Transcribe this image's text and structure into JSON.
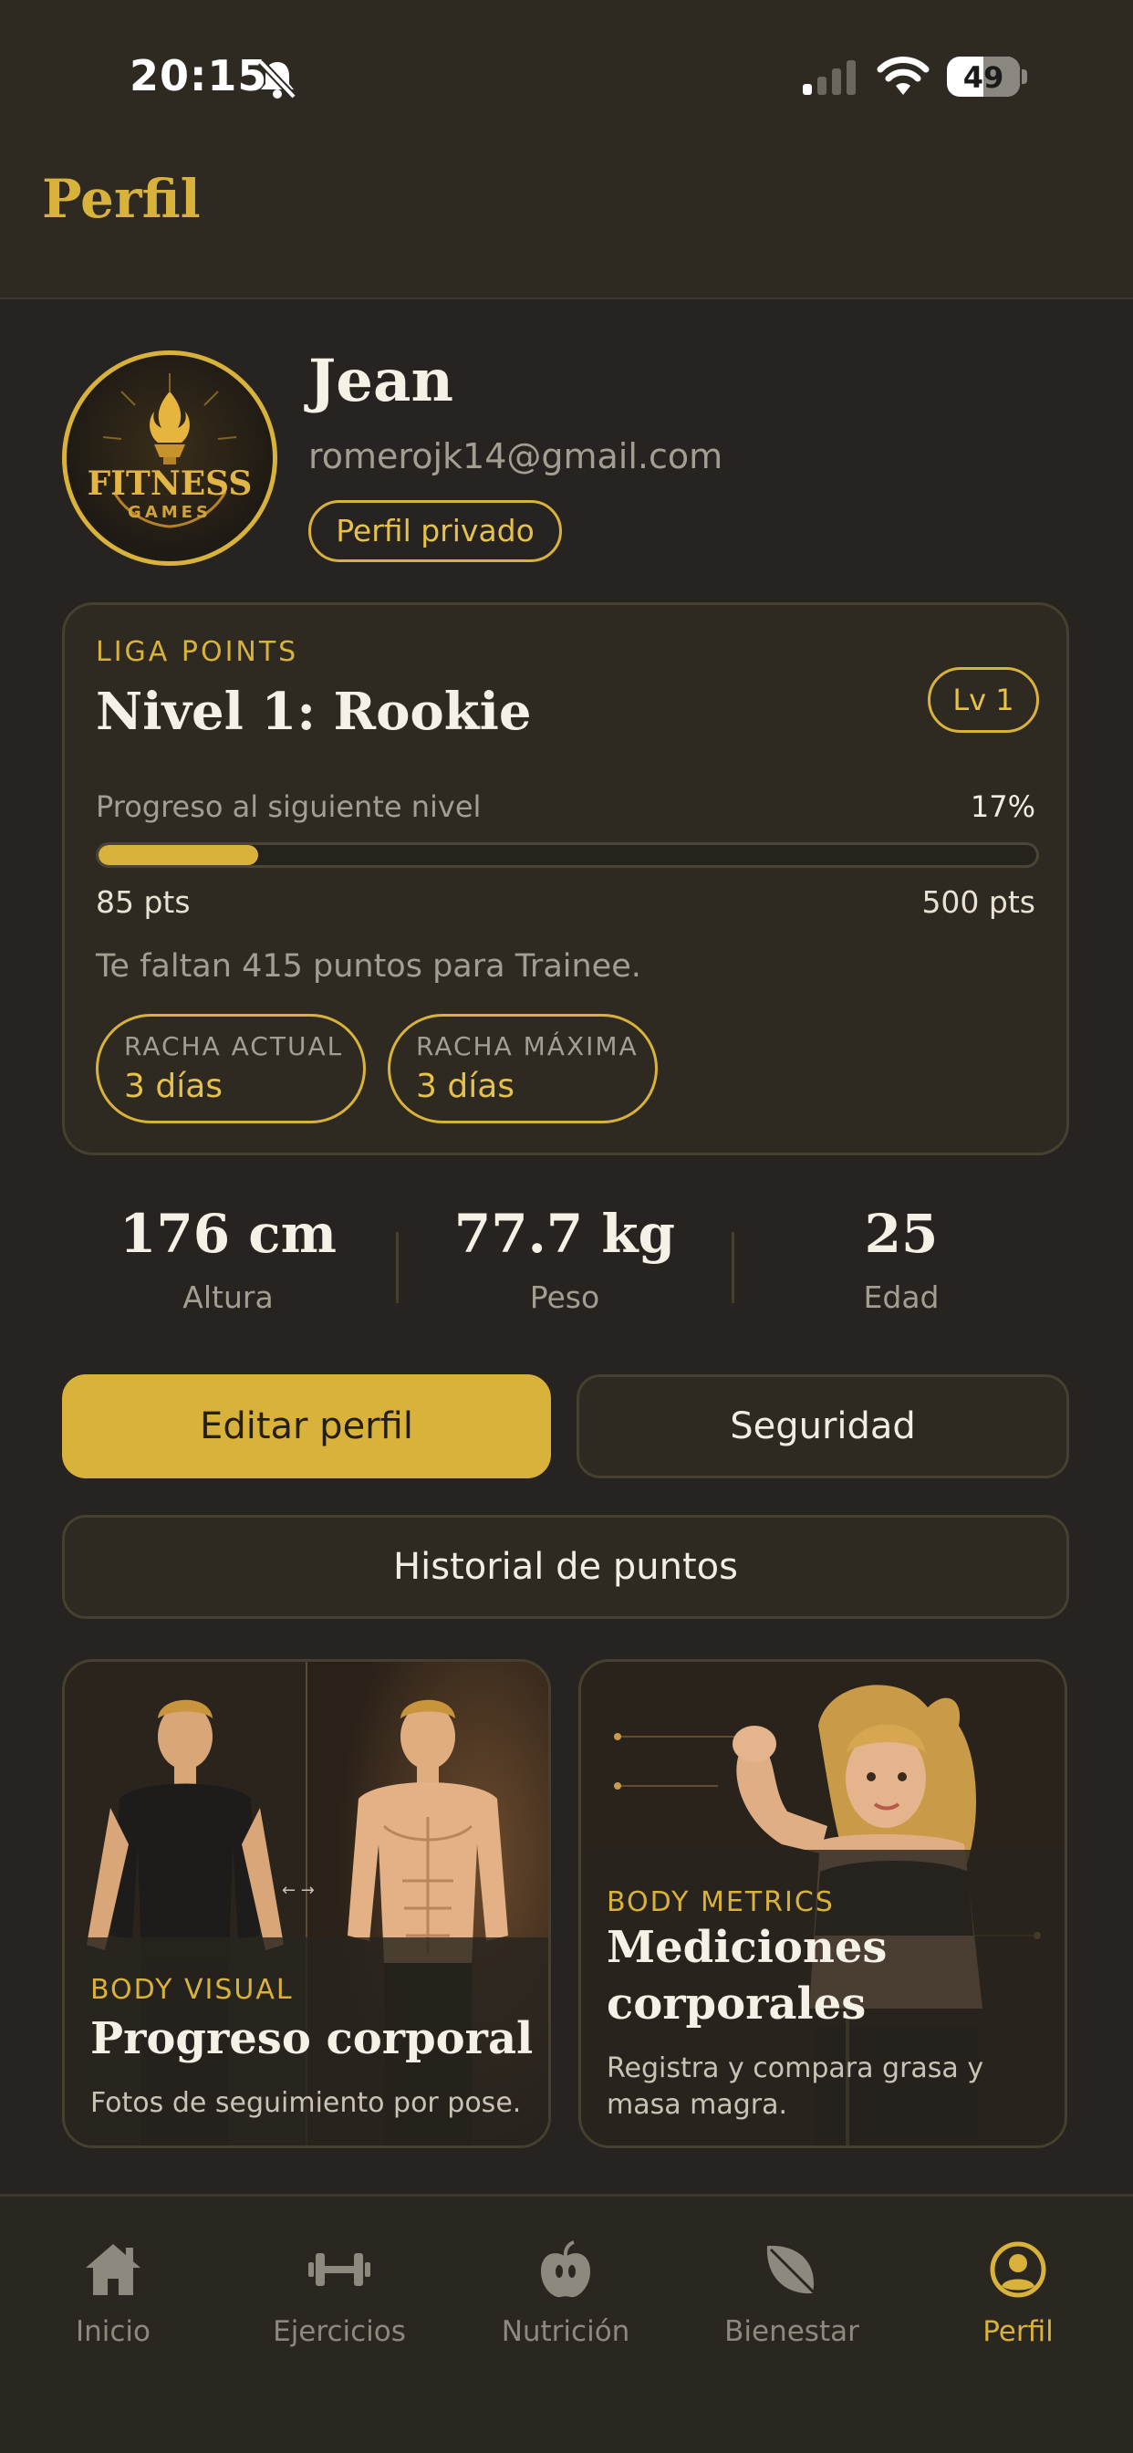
{
  "status_bar": {
    "time": "20:15",
    "battery": "49"
  },
  "header": {
    "title": "Perfil"
  },
  "profile": {
    "name": "Jean",
    "email": "romerojk14@gmail.com",
    "privacy_badge": "Perfil privado",
    "avatar_logo_line1": "FITNESS",
    "avatar_logo_line2": "GAMES"
  },
  "league": {
    "label": "LIGA POINTS",
    "level_title": "Nivel 1: Rookie",
    "level_badge": "Lv 1",
    "progress_label": "Progreso al siguiente nivel",
    "progress_percent_text": "17%",
    "progress_value": 0.17,
    "points_current": "85 pts",
    "points_next": "500 pts",
    "remaining_text": "Te faltan 415 puntos para Trainee.",
    "streaks": [
      {
        "label": "RACHA ACTUAL",
        "value": "3 días"
      },
      {
        "label": "RACHA MÁXIMA",
        "value": "3 días"
      }
    ]
  },
  "stats": [
    {
      "value": "176 cm",
      "label": "Altura"
    },
    {
      "value": "77.7 kg",
      "label": "Peso"
    },
    {
      "value": "25",
      "label": "Edad"
    }
  ],
  "buttons": {
    "edit_profile": "Editar perfil",
    "security": "Seguridad",
    "points_history": "Historial de puntos"
  },
  "feature_cards": [
    {
      "eyebrow": "BODY VISUAL",
      "title": "Progreso corporal",
      "description": "Fotos de seguimiento por pose."
    },
    {
      "eyebrow": "BODY METRICS",
      "title_line1": "Mediciones",
      "title_line2": "corporales",
      "description_line1": "Registra y compara grasa y",
      "description_line2": "masa magra."
    }
  ],
  "nav": {
    "items": [
      {
        "label": "Inicio",
        "icon": "home-icon"
      },
      {
        "label": "Ejercicios",
        "icon": "dumbbell-icon"
      },
      {
        "label": "Nutrición",
        "icon": "apple-icon"
      },
      {
        "label": "Bienestar",
        "icon": "leaf-icon"
      },
      {
        "label": "Perfil",
        "icon": "profile-icon"
      }
    ],
    "active_index": 4
  },
  "colors": {
    "accent": "#d8b23a",
    "background": "#262320",
    "card": "#2e2a21"
  }
}
